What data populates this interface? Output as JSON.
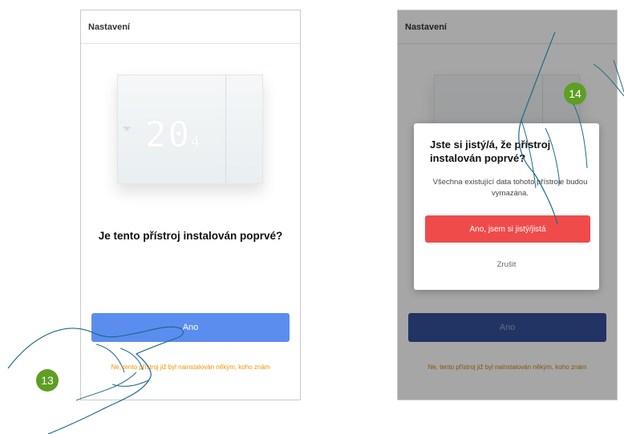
{
  "left_screen": {
    "header": "Nastavení",
    "thermostat_display": "20",
    "thermostat_decimal": "4",
    "question": "Je tento přístroj instalován poprvé?",
    "primary_button": "Ano",
    "secondary_link": "Ne, tento přístroj již byl nainstalován někým, koho znám",
    "step_badge": "13"
  },
  "right_screen": {
    "header": "Nastavení",
    "primary_button": "Ano",
    "secondary_link": "Ne, tento přístroj již byl nainstalován někým, koho znám",
    "step_badge": "14",
    "modal": {
      "title": "Jste si jistý/á, že přístroj instalován poprvé?",
      "description": "Všechna existující data tohoto přístroje budou vymazána.",
      "confirm_button": "Ano, jsem si jistý/jistá",
      "cancel_button": "Zrušit"
    }
  },
  "colors": {
    "primary_blue": "#5b8def",
    "confirm_red": "#ef4b4b",
    "link_orange": "#f39200",
    "badge_green": "#5e9e23"
  }
}
